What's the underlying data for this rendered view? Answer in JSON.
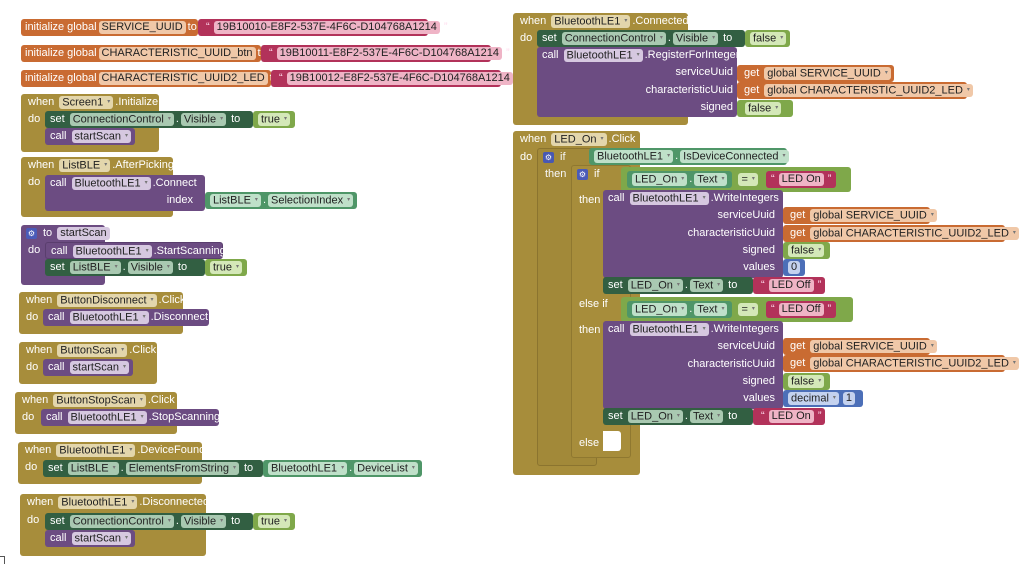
{
  "globals": [
    {
      "kw": "initialize global",
      "name": "SERVICE_UUID",
      "to": "to",
      "value": "19B10010-E8F2-537E-4F6C-D104768A1214"
    },
    {
      "kw": "initialize global",
      "name": "CHARACTERISTIC_UUID_btn",
      "to": "to",
      "value": "19B10011-E8F2-537E-4F6C-D104768A1214"
    },
    {
      "kw": "initialize global",
      "name": "CHARACTERISTIC_UUID2_LED",
      "to": "to",
      "value": "19B10012-E8F2-537E-4F6C-D104768A1214"
    }
  ],
  "kw": {
    "when": "when",
    "do": "do",
    "set": "set",
    "call": "call",
    "to": "to",
    "dot": ".",
    "get": "get",
    "if": "if",
    "then": "then",
    "else_if": "else if",
    "else": "else",
    "eq": "=",
    "quote": "“",
    "quote_end": "”",
    "dropdown": "▾",
    "gear": "⚙"
  },
  "screen_init": {
    "component": "Screen1",
    "event": ".Initialize",
    "set_comp": "ConnectionControl",
    "set_prop": "Visible",
    "set_val": "true",
    "call_proc": "startScan"
  },
  "list_after": {
    "component": "ListBLE",
    "event": ".AfterPicking",
    "call_comp": "BluetoothLE1",
    "call_method": ".Connect",
    "arg": "index",
    "get_comp": "ListBLE",
    "get_prop": "SelectionIndex"
  },
  "proc_start": {
    "to": "to",
    "name": "startScan",
    "call_comp": "BluetoothLE1",
    "call_method": ".StartScanning",
    "set_comp": "ListBLE",
    "set_prop": "Visible",
    "set_val": "true"
  },
  "btn_disconnect": {
    "component": "ButtonDisconnect",
    "event": ".Click",
    "call_comp": "BluetoothLE1",
    "call_method": ".Disconnect"
  },
  "btn_scan": {
    "component": "ButtonScan",
    "event": ".Click",
    "call_proc": "startScan"
  },
  "btn_stop": {
    "component": "ButtonStopScan",
    "event": ".Click",
    "call_comp": "BluetoothLE1",
    "call_method": ".StopScanning"
  },
  "device_found": {
    "component": "BluetoothLE1",
    "event": ".DeviceFound",
    "set_comp": "ListBLE",
    "set_prop": "ElementsFromString",
    "get_comp": "BluetoothLE1",
    "get_prop": "DeviceList"
  },
  "disconnected": {
    "component": "BluetoothLE1",
    "event": ".Disconnected",
    "set_comp": "ConnectionControl",
    "set_prop": "Visible",
    "set_val": "true",
    "call_proc": "startScan"
  },
  "connected": {
    "component": "BluetoothLE1",
    "event": ".Connected",
    "set_comp": "ConnectionControl",
    "set_prop": "Visible",
    "set_val": "false",
    "call_comp": "BluetoothLE1",
    "call_method": ".RegisterForIntegers",
    "arg1": "serviceUuid",
    "val1": "global SERVICE_UUID",
    "arg2": "characteristicUuid",
    "val2": "global CHARACTERISTIC_UUID2_LED",
    "arg3": "signed",
    "val3": "false"
  },
  "led_click": {
    "component": "LED_On",
    "event": ".Click",
    "cond_comp": "BluetoothLE1",
    "cond_prop": "IsDeviceConnected",
    "cmp_comp": "LED_On",
    "cmp_prop": "Text",
    "branch1": {
      "cmp_val": "LED On",
      "call_comp": "BluetoothLE1",
      "call_method": ".WriteIntegers",
      "arg1": "serviceUuid",
      "val1": "global SERVICE_UUID",
      "arg2": "characteristicUuid",
      "val2": "global CHARACTERISTIC_UUID2_LED",
      "arg3": "signed",
      "val3": "false",
      "arg4": "values",
      "val4": "0",
      "set_comp": "LED_On",
      "set_prop": "Text",
      "set_val": "LED Off"
    },
    "branch2": {
      "cmp_val": "LED Off",
      "call_comp": "BluetoothLE1",
      "call_method": ".WriteIntegers",
      "arg1": "serviceUuid",
      "val1": "global SERVICE_UUID",
      "arg2": "characteristicUuid",
      "val2": "global CHARACTERISTIC_UUID2_LED",
      "arg3": "signed",
      "val3": "false",
      "arg4": "values",
      "val4_mode": "decimal",
      "val4": "1",
      "set_comp": "LED_On",
      "set_prop": "Text",
      "set_val": "LED On"
    }
  }
}
